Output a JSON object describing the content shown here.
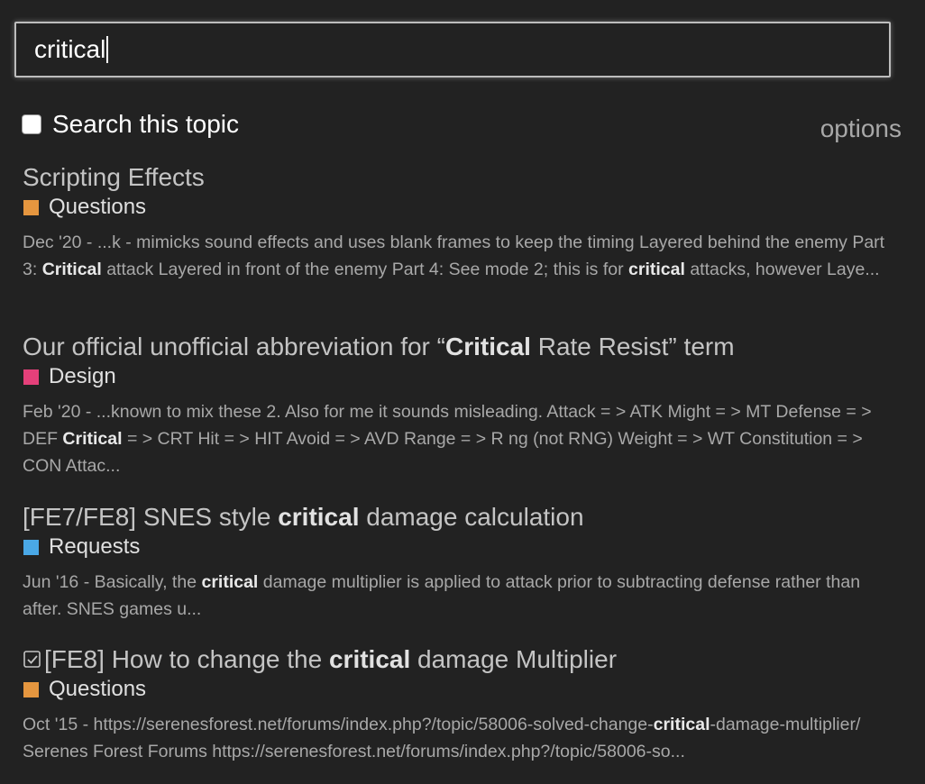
{
  "search": {
    "value": "critical"
  },
  "topic_filter": {
    "label": "Search this topic",
    "checked": false
  },
  "options_label": "options",
  "results": [
    {
      "title_parts": [
        {
          "t": "Scripting Effects",
          "b": false
        }
      ],
      "category": "Questions",
      "category_color": "#e5963f",
      "snippet_parts": [
        {
          "t": "Dec '20 - ...k - mimicks sound effects and uses blank frames to keep the timing Layered behind the enemy Part 3: ",
          "b": false
        },
        {
          "t": "Critical",
          "b": true
        },
        {
          "t": " attack Layered in front of the enemy Part 4: See mode 2; this is for ",
          "b": false
        },
        {
          "t": "critical",
          "b": true
        },
        {
          "t": " attacks, however Laye...",
          "b": false
        }
      ]
    },
    {
      "title_parts": [
        {
          "t": "Our official unofficial abbreviation for “",
          "b": false
        },
        {
          "t": "Critical",
          "b": true
        },
        {
          "t": " Rate Resist” term",
          "b": false
        }
      ],
      "category": "Design",
      "category_color": "#e5407a",
      "snippet_parts": [
        {
          "t": "Feb '20 - ...known to mix these 2. Also for me it sounds misleading. Attack = > ATK Might = > MT Defense = > DEF ",
          "b": false
        },
        {
          "t": "Critical",
          "b": true
        },
        {
          "t": " = > CRT Hit = > HIT Avoid = > AVD Range = > R ng (not RNG) Weight = > WT Constitution = > CON Attac...",
          "b": false
        }
      ]
    },
    {
      "title_parts": [
        {
          "t": "[FE7/FE8] SNES style ",
          "b": false
        },
        {
          "t": "critical",
          "b": true
        },
        {
          "t": " damage calculation",
          "b": false
        }
      ],
      "category": "Requests",
      "category_color": "#4aa8e6",
      "snippet_parts": [
        {
          "t": "Jun '16 - Basically, the ",
          "b": false
        },
        {
          "t": "critical",
          "b": true
        },
        {
          "t": " damage multiplier is applied to attack prior to subtracting defense rather than after. SNES games u...",
          "b": false
        }
      ]
    },
    {
      "solved": true,
      "title_parts": [
        {
          "t": "[FE8] How to change the ",
          "b": false
        },
        {
          "t": "critical",
          "b": true
        },
        {
          "t": " damage Multiplier",
          "b": false
        }
      ],
      "category": "Questions",
      "category_color": "#e5963f",
      "snippet_parts": [
        {
          "t": "Oct '15 - https://serenesforest.net/forums/index.php?/topic/58006-solved-change-",
          "b": false
        },
        {
          "t": "critical",
          "b": true
        },
        {
          "t": "-damage-multiplier/ Serenes Forest Forums https://serenesforest.net/forums/index.php?/topic/58006-so...",
          "b": false
        }
      ]
    }
  ]
}
